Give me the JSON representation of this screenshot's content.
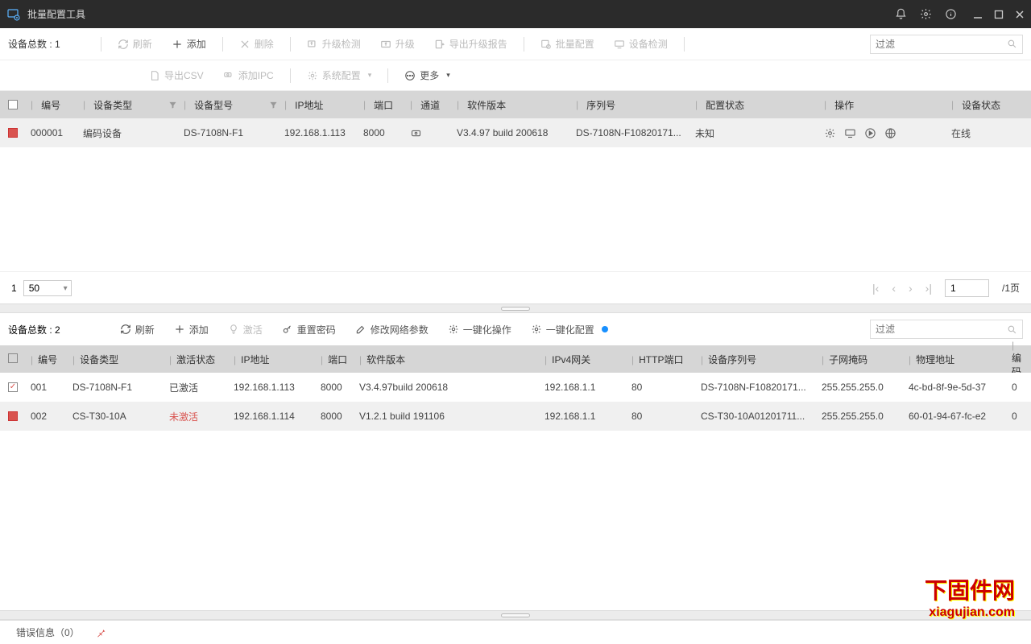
{
  "titlebar": {
    "title": "批量配置工具"
  },
  "panel1": {
    "count_label": "设备总数 : 1",
    "toolbar": {
      "refresh": "刷新",
      "add": "添加",
      "delete": "删除",
      "upgrade_check": "升级检测",
      "upgrade": "升级",
      "export_upgrade": "导出升级报告",
      "batch_config": "批量配置",
      "device_check": "设备检测",
      "export_csv": "导出CSV",
      "add_ipc": "添加IPC",
      "sys_config": "系统配置",
      "more": "更多"
    },
    "filter_placeholder": "过滤",
    "headers": {
      "id": "编号",
      "type": "设备类型",
      "model": "设备型号",
      "ip": "IP地址",
      "port": "端口",
      "channel": "通道",
      "version": "软件版本",
      "serial": "序列号",
      "config_status": "配置状态",
      "ops": "操作",
      "status": "设备状态"
    },
    "row": {
      "id": "000001",
      "type": "编码设备",
      "model": "DS-7108N-F1",
      "ip": "192.168.1.113",
      "port": "8000",
      "version": "V3.4.97 build 200618",
      "serial": "DS-7108N-F10820171...",
      "config_status": "未知",
      "status": "在线"
    },
    "pagination": {
      "page": "1",
      "size": "50",
      "input": "1",
      "total_label": "/1页"
    }
  },
  "panel2": {
    "count_label": "设备总数 : 2",
    "toolbar": {
      "refresh": "刷新",
      "add": "添加",
      "activate": "激活",
      "reset_pwd": "重置密码",
      "edit_net": "修改网络参数",
      "one_ops": "一键化操作",
      "one_cfg": "一键化配置"
    },
    "filter_placeholder": "过滤",
    "headers": {
      "id": "编号",
      "type": "设备类型",
      "act": "激活状态",
      "ip": "IP地址",
      "port": "端口",
      "version": "软件版本",
      "gw": "IPv4网关",
      "http": "HTTP端口",
      "serial": "设备序列号",
      "mask": "子网掩码",
      "mac": "物理地址",
      "more": "编码"
    },
    "rows": [
      {
        "id": "001",
        "type": "DS-7108N-F1",
        "act": "已激活",
        "ip": "192.168.1.113",
        "port": "8000",
        "version": "V3.4.97build 200618",
        "gw": "192.168.1.1",
        "http": "80",
        "serial": "DS-7108N-F10820171...",
        "mask": "255.255.255.0",
        "mac": "4c-bd-8f-9e-5d-37",
        "more": "0",
        "checked": true
      },
      {
        "id": "002",
        "type": "CS-T30-10A",
        "act": "未激活",
        "ip": "192.168.1.114",
        "port": "8000",
        "version": "V1.2.1 build 191106",
        "gw": "192.168.1.1",
        "http": "80",
        "serial": "CS-T30-10A01201711...",
        "mask": "255.255.255.0",
        "mac": "60-01-94-67-fc-e2",
        "more": "0",
        "checked": false
      }
    ]
  },
  "statusbar": {
    "label": "错误信息（0）"
  },
  "watermark": {
    "line1": "下固件网",
    "line2": "xiagujian.com"
  }
}
